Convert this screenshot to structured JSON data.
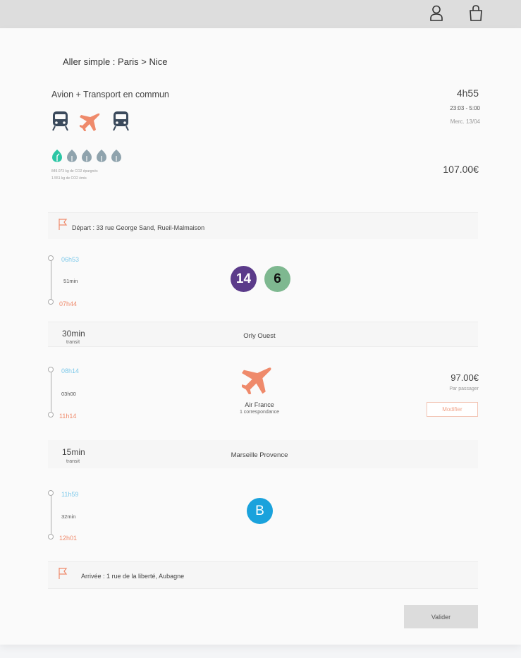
{
  "topbar": {
    "icons": [
      "user-icon",
      "shopping-bag-icon"
    ]
  },
  "trip": {
    "title": "Aller simple : Paris > Nice",
    "mode": "Avion + Transport en commun",
    "duration": "4h55",
    "times": "23:03 - 5:00",
    "date": "Merc. 13/04",
    "price": "107.00€",
    "eco_line1": "849.073 kg de CO2 épargnés",
    "eco_line2": "1.551 kg de CO2 émis",
    "eco_rating": {
      "value": 1,
      "max": 5
    },
    "transport_icons": [
      "train-icon",
      "plane-icon",
      "train-icon"
    ]
  },
  "departure": {
    "label": "Départ : 33 rue George Sand, Rueil-Malmaison"
  },
  "segment1": {
    "dep": "06h53",
    "dur": "51min",
    "arr": "07h44",
    "lines": [
      "14",
      "6"
    ]
  },
  "transit1": {
    "duration": "30min",
    "label": "transit",
    "place": "Orly Ouest"
  },
  "segment2": {
    "dep": "08h14",
    "dur": "03h00",
    "arr": "11h14",
    "airline": "Air France",
    "connections": "1 correspondance",
    "price": "97.00€",
    "per": "Par passager",
    "modify": "Modifier"
  },
  "transit2": {
    "duration": "15min",
    "label": "transit",
    "place": "Marseille Provence"
  },
  "segment3": {
    "dep": "11h59",
    "dur": "32min",
    "arr": "12h01",
    "line": "B"
  },
  "arrival": {
    "label": "Arrivée : 1 rue de la liberté, Aubagne"
  },
  "validate": "Valider",
  "colors": {
    "accent_orange": "#ef8a6b",
    "accent_blue": "#7ec9ea",
    "eco_active": "#2bc6a5",
    "eco_inactive": "#8fa3ad",
    "train": "#3b4a5c",
    "plane": "#ef8a6b"
  }
}
